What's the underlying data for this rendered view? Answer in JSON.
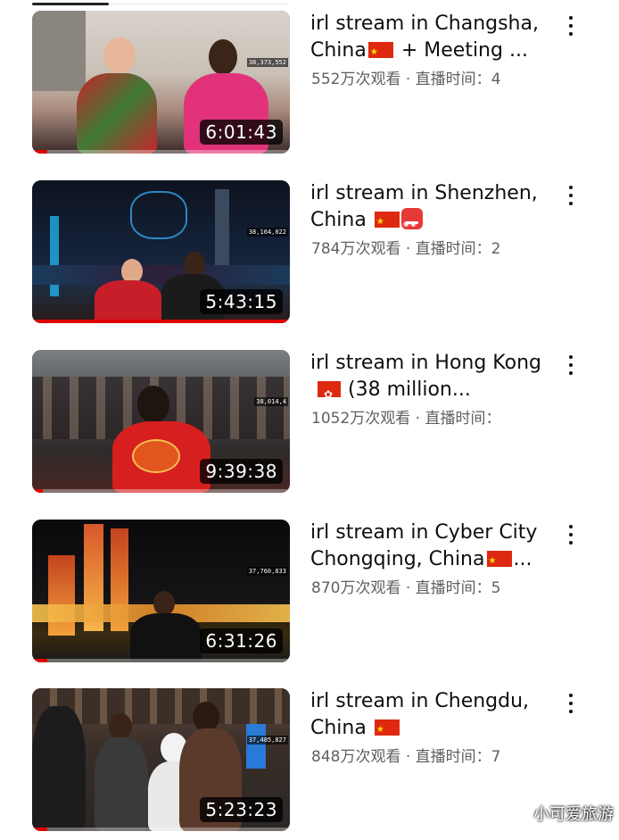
{
  "videos": [
    {
      "title": "irl stream in Changsha, China",
      "title_flags": [
        "cn"
      ],
      "title_suffix": " + Meeting ...",
      "views": "552万次观看",
      "separator": " · ",
      "live_label": "直播时间：",
      "live_value": "4",
      "duration": "6:01:43",
      "counter": "38,373,552",
      "progress": 0.06
    },
    {
      "title": "irl stream in Shenzhen, China",
      "title_flags": [
        "cn",
        "robot"
      ],
      "title_suffix": "",
      "views": "784万次观看",
      "separator": " · ",
      "live_label": "直播时间：",
      "live_value": "2",
      "duration": "5:43:15",
      "counter": "38,164,022",
      "progress": 1.0
    },
    {
      "title": "irl stream in Hong Kong",
      "title_flags": [
        "hk"
      ],
      "title_suffix": "(38 million...",
      "views": "1052万次观看",
      "separator": " · ",
      "live_label": "直播时间：",
      "live_value": "",
      "duration": "9:39:38",
      "counter": "38,014,4",
      "progress": 0.04
    },
    {
      "title": "irl stream in Cyber City Chongqing, China",
      "title_flags": [
        "cn"
      ],
      "title_suffix": "...",
      "views": "870万次观看",
      "separator": " · ",
      "live_label": "直播时间：",
      "live_value": "5",
      "duration": "6:31:26",
      "counter": "37,760,833",
      "progress": 0.06
    },
    {
      "title": "irl stream in Chengdu, China",
      "title_flags": [
        "cn"
      ],
      "title_suffix": "",
      "views": "848万次观看",
      "separator": " · ",
      "live_label": "直播时间：",
      "live_value": "7",
      "duration": "5:23:23",
      "counter": "37,485,827",
      "progress": 0.06
    }
  ],
  "watermark": "小可爱旅游",
  "icons": {
    "menu": "more-vert-icon"
  },
  "colors": {
    "progress": "#e00000",
    "title": "#0f0f0f",
    "meta": "#606060"
  }
}
